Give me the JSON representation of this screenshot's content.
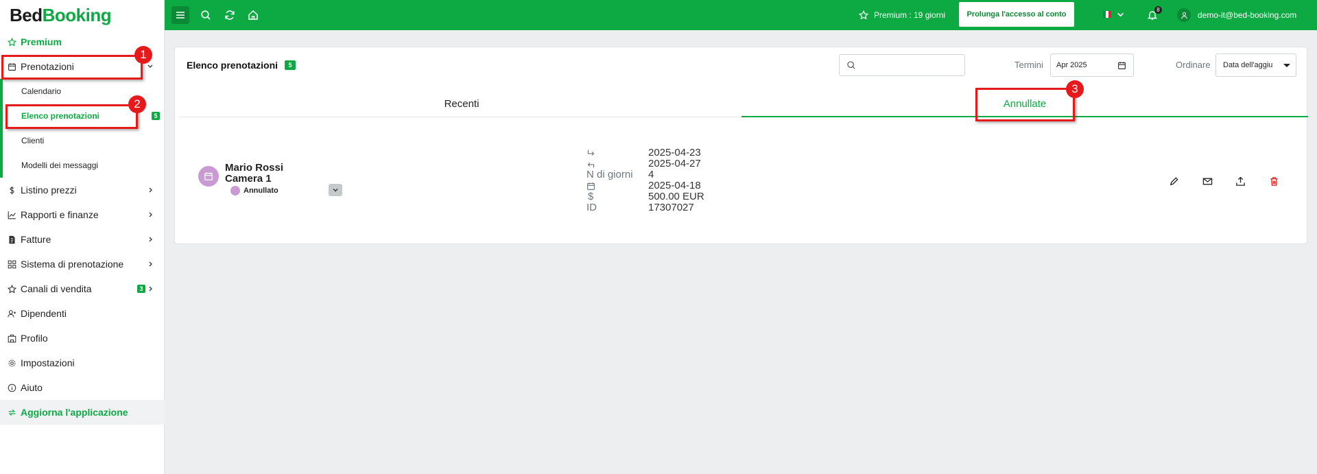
{
  "logo": {
    "part1": "Bed",
    "part2": "Booking"
  },
  "sidebar": {
    "premium": "Premium",
    "reservations": "Prenotazioni",
    "sub": {
      "calendar": "Calendario",
      "list": "Elenco prenotazioni",
      "list_badge": "5",
      "clients": "Clienti",
      "message_templates": "Modelli dei messaggi"
    },
    "price_list": "Listino prezzi",
    "reports": "Rapporti e finanze",
    "invoices": "Fatture",
    "booking_system": "Sistema di prenotazione",
    "sales_channels": "Canali di vendita",
    "sales_channels_badge": "3",
    "employees": "Dipendenti",
    "profile": "Profilo",
    "settings": "Impostazioni",
    "help": "Aiuto",
    "update_app": "Aggiorna l'applicazione"
  },
  "topbar": {
    "premium_text": "Premium : 19 giorni",
    "extend_button": "Prolunga l'accesso al conto",
    "notifications_count": "8",
    "user_email": "demo-it@bed-booking.com",
    "language_flag_colors": [
      "#009246",
      "#ffffff",
      "#ce2b37"
    ]
  },
  "main": {
    "title": "Elenco prenotazioni",
    "title_badge": "5",
    "search_placeholder": "",
    "terms_label": "Termini",
    "date_value": "Apr 2025",
    "sort_label": "Ordinare",
    "sort_value": "Data dell'aggiu",
    "tabs": {
      "recent": "Recenti",
      "cancelled": "Annullate"
    },
    "active_tab": "cancelled"
  },
  "reservation": {
    "guest": "Mario Rossi",
    "room": "Camera 1",
    "status": "Annullato",
    "nights_label": "N di giorni",
    "currency_label": "$",
    "id_label": "ID",
    "check_in": "2025-04-23",
    "check_out": "2025-04-27",
    "nights": "4",
    "created": "2025-04-18",
    "price": "500.00 EUR",
    "id": "17307027"
  },
  "annotations": {
    "one": "1",
    "two": "2",
    "three": "3"
  },
  "colors": {
    "brand_green": "#0da942",
    "cancelled_purple": "#c99ad3",
    "marker_red": "#e8191b"
  }
}
